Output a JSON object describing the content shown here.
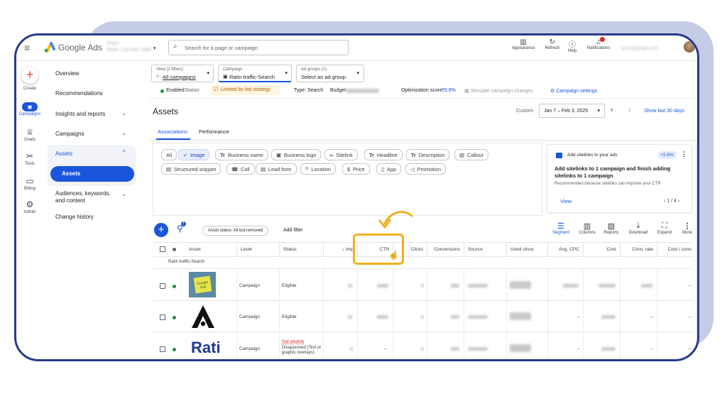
{
  "topbar": {
    "app_name": "Google Ads",
    "account_name_blurred": "Ratin",
    "account_id_blurred": "Ratin 123-456-7890",
    "search_placeholder": "Search for a page or campaign",
    "tools": [
      {
        "label": "Appearance",
        "icon": "appearance-icon"
      },
      {
        "label": "Refresh",
        "icon": "refresh-icon"
      },
      {
        "label": "Help",
        "icon": "help-icon"
      },
      {
        "label": "Notifications",
        "icon": "bell-icon"
      }
    ],
    "user_blurred": "user@gmail.com"
  },
  "rail": [
    {
      "label": "Create",
      "icon": "plus-icon"
    },
    {
      "label": "Campaigns",
      "icon": "campaigns-icon"
    },
    {
      "label": "Goals",
      "icon": "trophy-icon"
    },
    {
      "label": "Tools",
      "icon": "tools-icon"
    },
    {
      "label": "Billing",
      "icon": "billing-icon"
    },
    {
      "label": "Admin",
      "icon": "gear-icon"
    }
  ],
  "nav": {
    "overview": "Overview",
    "recommendations": "Recommendations",
    "insights": "Insights and reports",
    "campaigns": "Campaigns",
    "assets": "Assets",
    "assets_sub": "Assets",
    "audiences": "Audiences, keywords, and content",
    "change_history": "Change history"
  },
  "selectors": {
    "view_label": "View (2 filters)",
    "view_value": "All campaigns",
    "campaign_label": "Campaign",
    "campaign_value": "Ratin traffic-Search",
    "adgroup_label": "Ad groups (1)",
    "adgroup_value": "Select an ad group"
  },
  "status_bar": {
    "enabled": "Enabled",
    "status_label": "Status:",
    "status_value": "Limited by bid strategy",
    "type": "Type: Search",
    "budget_label": "Budget:",
    "opt_label": "Optimization score:",
    "opt_value": "78.8%",
    "simulate": "Simulate campaign changes",
    "settings": "Campaign settings"
  },
  "page": {
    "title": "Assets",
    "date_label": "Custom",
    "date_range": "Jan 7 – Feb 3, 2025",
    "show_last": "Show last 30 days",
    "tabs": [
      "Associations",
      "Performance"
    ]
  },
  "chips_row1": [
    "All",
    "Image",
    "Business name",
    "Business logo",
    "Sitelink",
    "Headline",
    "Description",
    "Callout"
  ],
  "chips_row2": [
    "Structured snippet",
    "Call",
    "Lead form",
    "Location",
    "Price",
    "App",
    "Promotion"
  ],
  "rec_card": {
    "title": "Add sitelinks to your ads",
    "badge": "+2.8%",
    "headline": "Add sitelinks to 1 campaign and finish adding sitelinks to 1 campaign",
    "note": "Recommended because sitelinks can improve your CTR",
    "view": "View",
    "pager": "1 / 4"
  },
  "toolbar": {
    "filter_badge": "1",
    "asset_status": "Asset status: All but removed",
    "add_filter": "Add filter",
    "tools": [
      "Segment",
      "Columns",
      "Reports",
      "Download",
      "Expand",
      "More"
    ]
  },
  "table": {
    "headers": [
      "Asset",
      "Level",
      "Status",
      "Imp",
      "CTR",
      "Clicks",
      "Conversions",
      "Source",
      "Used since",
      "Avg. CPC",
      "Cost",
      "Conv. rate",
      "Cost / conv."
    ],
    "group_label": "Ratin traffic-Search",
    "rows": [
      {
        "asset": "Google Ads",
        "level": "Campaign",
        "status": "Eligible",
        "cost_conv": "–"
      },
      {
        "asset": "",
        "level": "Campaign",
        "status": "Eligible",
        "avg_cpc": "–",
        "conv_rate": "–",
        "cost_conv": "–"
      },
      {
        "asset": "Rati",
        "level": "Campaign",
        "status": "Not eligible",
        "status_detail": "Disapproved (Text or graphic overlays)",
        "ctr": "–",
        "avg_cpc": "–",
        "conv_rate": "–",
        "cost_conv": "–"
      }
    ]
  },
  "colors": {
    "brand_blue": "#1a73e8",
    "frame_navy": "#283a8c",
    "highlight": "#f2b01e",
    "nav_active": "#1a56db",
    "green": "#1e8e3e",
    "red": "#d93025"
  }
}
